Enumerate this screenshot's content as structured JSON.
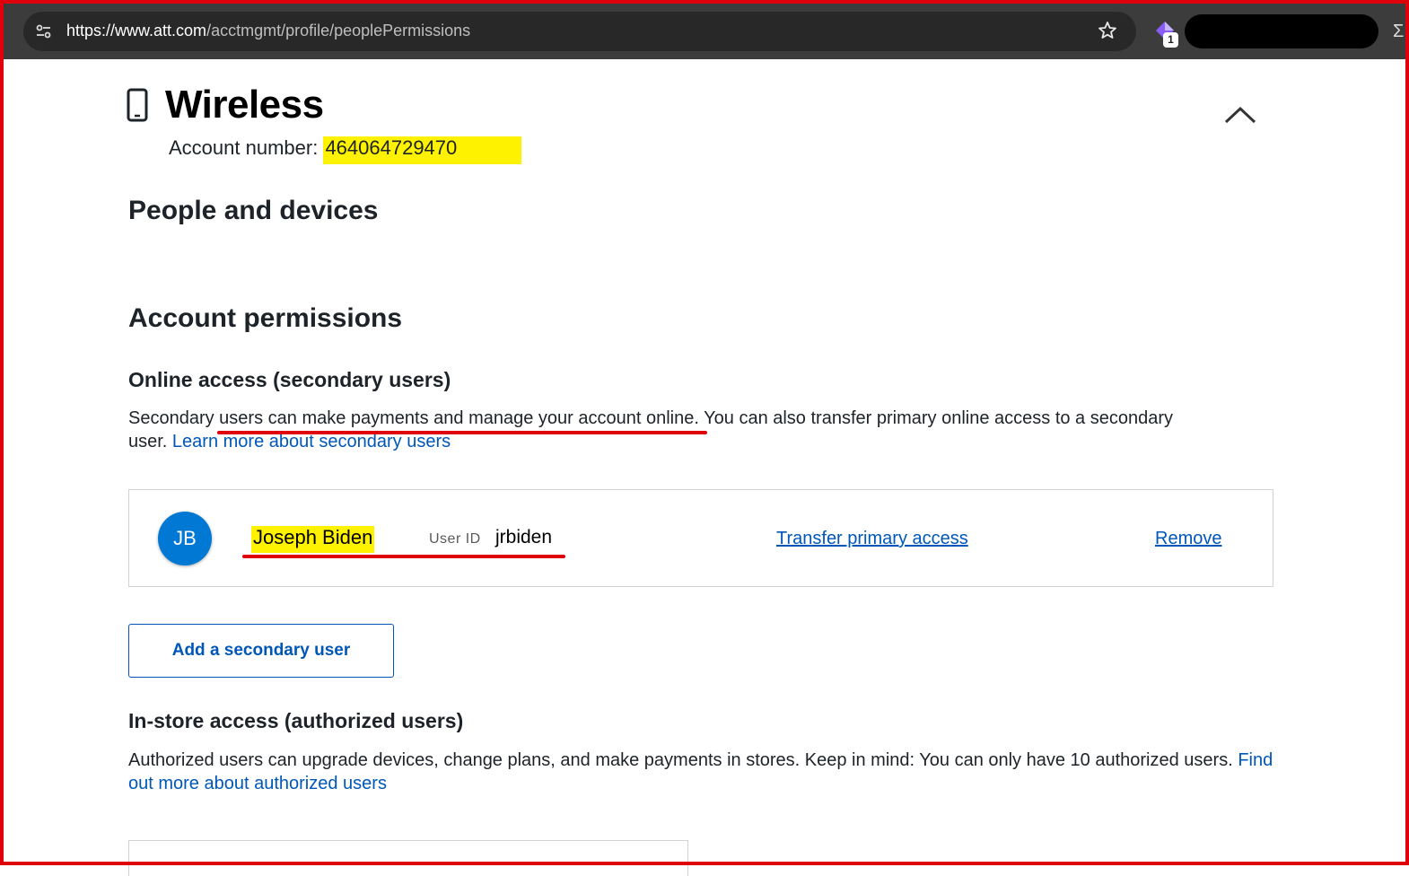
{
  "browser": {
    "url_host": "https://www.att.com",
    "url_path": "/acctmgmt/profile/peoplePermissions",
    "extension_badge": "1"
  },
  "wireless": {
    "title": "Wireless",
    "account_label": "Account number: ",
    "account_number": "464064729470"
  },
  "sections": {
    "people_devices": "People and devices",
    "account_permissions": "Account permissions",
    "online_access": "Online access (secondary users)",
    "online_text_1": "Secondary ",
    "online_text_2": "users can make payments and manage your account online.",
    "online_text_3": " You can also transfer primary online access to a secondary user. ",
    "online_link": "Learn more about secondary users",
    "instore_access": "In-store access (authorized users)",
    "instore_text": "Authorized users can upgrade devices, change plans, and make payments in stores. Keep in mind: You can only have 10 authorized users. ",
    "instore_link": "Find out more about authorized users"
  },
  "secondary_user": {
    "initials": "JB",
    "name": "Joseph Biden",
    "user_id_label": "User ID",
    "user_id": "jrbiden",
    "transfer_label": "Transfer primary access",
    "remove_label": "Remove"
  },
  "buttons": {
    "add_secondary": "Add a secondary user"
  },
  "colors": {
    "link": "#0057b8",
    "highlight": "#fff200",
    "annotation": "#e0000b",
    "avatar": "#0078d4"
  }
}
